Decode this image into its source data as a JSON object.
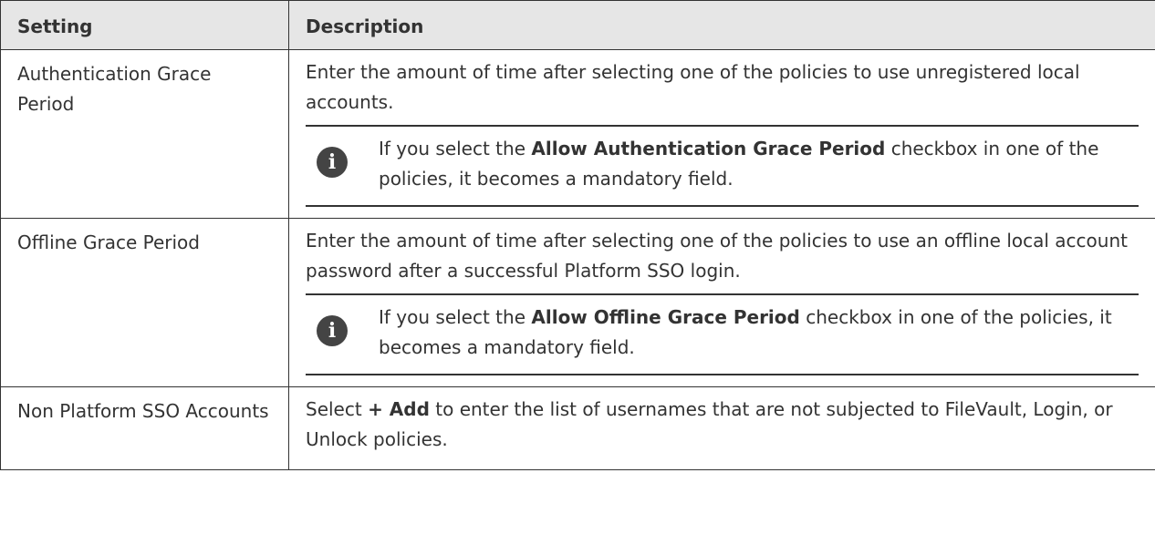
{
  "header": {
    "col_setting": "Setting",
    "col_description": "Description"
  },
  "rows": [
    {
      "setting": "Authentication Grace Period",
      "description": "Enter the amount of time after selecting one of the policies to use unregistered local accounts.",
      "note": {
        "icon": "info-icon",
        "pre": "If you select the ",
        "bold": "Allow Authentication Grace Period",
        "post": " checkbox in one of the policies, it becomes a mandatory field."
      }
    },
    {
      "setting": "Offline Grace Period",
      "description": "Enter the amount of time after selecting one of the policies to use an offline local account password after a successful Platform SSO login.",
      "note": {
        "icon": "info-icon",
        "pre": "If you select the ",
        "bold": "Allow Offline Grace Period",
        "post": " checkbox in one of the policies, it becomes a mandatory field."
      }
    },
    {
      "setting": "Non Platform SSO Accounts",
      "description_pre": "Select ",
      "description_bold": "+ Add",
      "description_post": " to enter the list of usernames that are not subjected to FileVault, Login, or Unlock policies."
    }
  ],
  "colors": {
    "header_bg": "#e6e6e6",
    "border": "#333333",
    "icon_bg": "#444444"
  }
}
